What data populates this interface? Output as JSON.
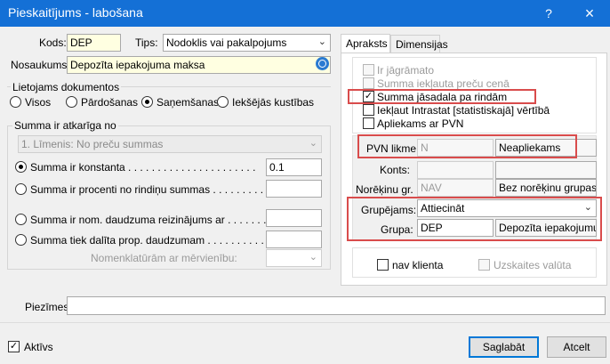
{
  "window": {
    "title": "Pieskaitījums - labošana",
    "help_btn": "?",
    "close_btn": "×"
  },
  "left": {
    "kods_label": "Kods:",
    "kods_value": "DEP",
    "tips_label": "Tips:",
    "tips_value": "Nodoklis vai pakalpojums",
    "nosaukums_label": "Nosaukums:",
    "nosaukums_value": "Depozīta iepakojuma maksa",
    "lietojams_title": "Lietojams dokumentos",
    "doc_options": [
      "Visos",
      "Pārdošanas",
      "Saņemšanas",
      "Iekšējās kustības"
    ],
    "doc_selected": "Saņemšanas",
    "summa_title": "Summa ir atkarīga no",
    "limenis_value": "1. Līmenis: No preču summas",
    "opt1": "Summa ir konstanta . . . . . . . . . . . . . . . . . . . . . .",
    "opt1_value": "0.1",
    "opt2": "Summa ir procenti no rindiņu summas . . . . . . . . . .",
    "opt3": "Summa ir nom. daudzuma reizinājums ar . . . . . . . . .",
    "opt4": "Summa tiek dalīta prop. daudzumam . . . . . . . . . . .",
    "nomenklaturam": "Nomenklatūrām ar mērvienību:"
  },
  "tabs": [
    "Apraksts",
    "Dimensijas"
  ],
  "right": {
    "checkboxes": [
      {
        "label": "Ir jāgrāmato",
        "checked": false,
        "disabled": true
      },
      {
        "label": "Summa iekļauta preču cenā",
        "checked": false,
        "disabled": true
      },
      {
        "label": "Summa jāsadala pa rindām",
        "checked": true,
        "disabled": false
      },
      {
        "label": "Iekļaut Intrastat [statistiskajā] vērtībā",
        "checked": false,
        "disabled": false
      },
      {
        "label": "Apliekams ar PVN",
        "checked": false,
        "disabled": false
      }
    ],
    "pvn_label": "PVN likme:",
    "pvn_value": "N",
    "pvn_desc": "Neapliekams",
    "konts_label": "Konts:",
    "noreк_label": "Norēķinu gr.",
    "norek_value": "NAV",
    "norek_desc": "Bez norēķinu grupas",
    "grupejams_label": "Grupējams:",
    "grupejams_value": "Attiecināt",
    "grupa_label": "Grupa:",
    "grupa_value": "DEP",
    "grupa_desc": "Depozīta iepakojumu u",
    "nav_klienta": "nav klienta",
    "uzskaites_valuta": "Uzskaites valūta"
  },
  "piezimes_label": "Piezīmes:",
  "aktivs_label": "Aktīvs",
  "save_label": "Saglabāt",
  "cancel_label": "Atcelt",
  "colors": {
    "titlebar": "#1470d6",
    "highlight_red": "#d94c4c",
    "yellow_field": "#ffffe1"
  }
}
